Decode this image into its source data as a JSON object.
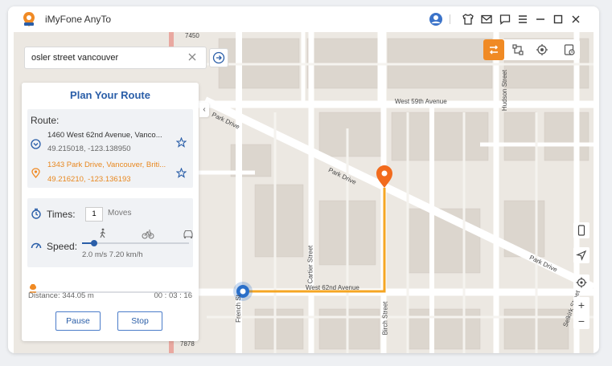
{
  "app": {
    "title": "iMyFone AnyTo"
  },
  "search": {
    "value": "osler street vancouver",
    "placeholder": ""
  },
  "panel": {
    "title": "Plan Your Route",
    "route_label": "Route:",
    "start": {
      "address": "1460 West 62nd Avenue, Vanco...",
      "coords": "49.215018, -123.138950"
    },
    "end": {
      "address": "1343 Park Drive, Vancouver, Briti...",
      "coords": "49.216210, -123.136193"
    },
    "times_label": "Times:",
    "times_value": "1",
    "moves_label": "Moves",
    "speed_label": "Speed:",
    "speed_value": "2.0 m/s  7.20 km/h",
    "distance": "Distance: 344.05 m",
    "time": "00 : 03 : 16",
    "pause_label": "Pause",
    "stop_label": "Stop",
    "progress_fraction": 0.02
  },
  "map": {
    "labels": {
      "w59": "West 59th Avenue",
      "park1": "Park Drive",
      "park2": "Park Drive",
      "park3": "Park Drive",
      "w62": "West 62nd Avenue",
      "hudson": "Hudson Street",
      "cartier": "Cartier Street",
      "french": "French St",
      "birch": "Birch Street",
      "selkirk": "Selkirk Street",
      "n7450": "7450",
      "n7878": "7878"
    },
    "colors": {
      "route": "#f5a623",
      "pin": "#f26b1d",
      "accent": "#f08a24",
      "location": "#2a6fc9"
    }
  }
}
